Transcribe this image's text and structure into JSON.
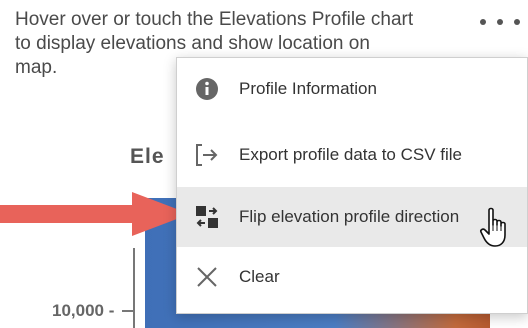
{
  "instructions": {
    "line1": "Hover over or touch the Elevations Profile chart",
    "line2": "to display elevations and show location on",
    "line3": "map."
  },
  "chart": {
    "title_fragment": "Ele",
    "y_tick_label": "10,000 -"
  },
  "menu": {
    "items": [
      {
        "label": "Profile Information",
        "icon": "info-circle-icon"
      },
      {
        "label": "Export profile data to CSV file",
        "icon": "export-icon"
      },
      {
        "label": "Flip elevation profile direction",
        "icon": "flip-icon"
      },
      {
        "label": "Clear",
        "icon": "close-icon"
      }
    ],
    "hovered_index": 2
  },
  "colors": {
    "arrow": "#e8635a",
    "menu_hover": "#e9e9e9",
    "chart_blue": "#4b7dc3",
    "chart_orange": "#c26a3c"
  }
}
